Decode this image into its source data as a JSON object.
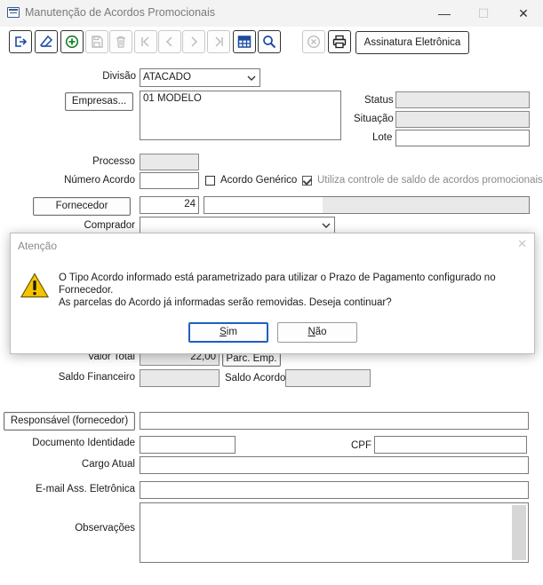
{
  "window": {
    "title": "Manutenção de Acordos Promocionais",
    "minimize": "—",
    "maximize": "☐",
    "close": "✕"
  },
  "toolbar": {
    "assinatura_label": "Assinatura Eletrônica",
    "icons": [
      "exit-icon",
      "eraser-icon",
      "add-icon",
      "save-icon",
      "delete-icon",
      "first-record-icon",
      "previous-record-icon",
      "next-record-icon",
      "last-record-icon",
      "grid-icon",
      "search-icon",
      "cancel-icon",
      "print-icon"
    ]
  },
  "form": {
    "divisao_label": "Divisão",
    "divisao_value": "ATACADO",
    "empresas_button": "Empresas...",
    "empresas_list": [
      "01 MODELO"
    ],
    "status_label": "Status",
    "situacao_label": "Situação",
    "lote_label": "Lote",
    "processo_label": "Processo",
    "numero_acordo_label": "Número Acordo",
    "acordo_generico_label": "Acordo Genérico",
    "utiliza_controle_label": "Utiliza controle de saldo de acordos promocionais",
    "fornecedor_button": "Fornecedor",
    "fornecedor_code": "24",
    "comprador_label": "Comprador",
    "valor_total_label": "Valor Total",
    "valor_total_value": "22,00",
    "parc_emp_button": "Parc. Emp.",
    "saldo_financeiro_label": "Saldo Financeiro",
    "saldo_acordo_label": "Saldo Acordo",
    "responsavel_button": "Responsável (fornecedor)",
    "documento_label": "Documento Identidade",
    "cpf_label": "CPF",
    "cargo_label": "Cargo Atual",
    "email_label": "E-mail Ass. Eletrônica",
    "observacoes_label": "Observações"
  },
  "dialog": {
    "title": "Atenção",
    "close": "✕",
    "message_line1": "O Tipo Acordo informado está parametrizado para utilizar o Prazo de Pagamento configurado no Fornecedor.",
    "message_line2": "As parcelas do Acordo já informadas serão removidas. Deseja continuar?",
    "yes_first": "S",
    "yes_rest": "im",
    "no_first": "N",
    "no_rest": "ão"
  }
}
